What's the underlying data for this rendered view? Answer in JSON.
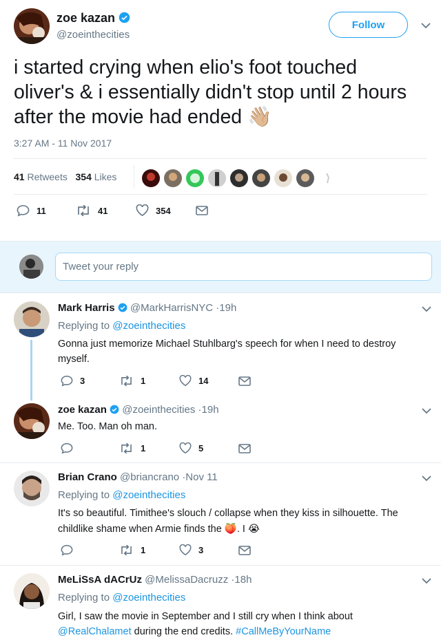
{
  "main_tweet": {
    "name": "zoe kazan",
    "handle": "@zoeinthecities",
    "follow_label": "Follow",
    "text": "i started crying when elio's foot touched oliver's & i essentially didn't stop until 2 hours after the movie had ended",
    "emoji": "👋🏼",
    "timestamp": "3:27 AM - 11 Nov 2017",
    "retweet_count": "41",
    "retweet_label": "Retweets",
    "like_count": "354",
    "like_label": "Likes",
    "actions": {
      "replies": "11",
      "retweets": "41",
      "likes": "354"
    }
  },
  "reply_box": {
    "placeholder": "Tweet your reply"
  },
  "replies": [
    {
      "name": "Mark Harris",
      "handle": "@MarkHarrisNYC",
      "time": "·19h",
      "replying_prefix": "Replying to",
      "replying_to": "@zoeinthecities",
      "text": "Gonna just memorize Michael Stuhlbarg's speech for when I need to destroy myself.",
      "actions": {
        "replies": "3",
        "retweets": "1",
        "likes": "14"
      }
    },
    {
      "name": "zoe kazan",
      "handle": "@zoeinthecities",
      "time": "·19h",
      "text": "Me. Too. Man oh man.",
      "actions": {
        "replies": "",
        "retweets": "1",
        "likes": "5"
      }
    },
    {
      "name": "Brian Crano",
      "handle": "@briancrano",
      "time": "·Nov 11",
      "replying_prefix": "Replying to",
      "replying_to": "@zoeinthecities",
      "text_1": "It's so beautiful. Timithee's slouch / collapse when they kiss in silhouette.  The",
      "text_2": "childlike shame when Armie finds the",
      "emoji": "🍑. I 😭",
      "actions": {
        "replies": "",
        "retweets": "1",
        "likes": "3"
      }
    },
    {
      "name": "MeLiSsA dACrUz",
      "handle": "@MelissaDacruzz",
      "time": "·18h",
      "replying_prefix": "Replying to",
      "replying_to": "@zoeinthecities",
      "text_1": "Girl, I saw the movie in September and I still cry when I think about",
      "mention": "@RealChalamet",
      "text_2": "during the end credits.",
      "hashtag": "#CallMeByYourName"
    }
  ],
  "colors": {
    "accent": "#1da1f2",
    "link": "#1b95e0",
    "muted": "#657786",
    "border": "#e6ecf0"
  }
}
